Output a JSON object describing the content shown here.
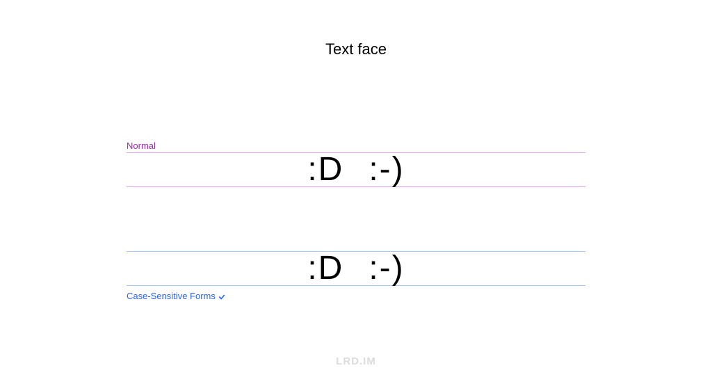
{
  "title": "Text face",
  "sections": {
    "normal": {
      "label": "Normal",
      "samples": [
        ":D",
        ":-)"
      ]
    },
    "case_sensitive": {
      "label": "Case-Sensitive Forms",
      "samples": [
        ":D",
        ":-)"
      ]
    }
  },
  "watermark": "LRD.IM",
  "colors": {
    "normal_accent": "#9c27b0",
    "case_accent": "#2962ff",
    "normal_rule": "#e1a8ee",
    "case_rule": "#a8c7ff"
  }
}
